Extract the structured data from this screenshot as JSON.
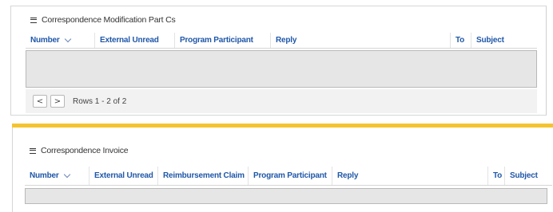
{
  "panel1": {
    "title": "Correspondence Modification Part Cs",
    "columns": [
      "Number",
      "External Unread",
      "Program Participant",
      "Reply",
      "To",
      "Subject"
    ],
    "pagination": {
      "prev_label": "<",
      "next_label": ">",
      "rows_text": "Rows 1 - 2 of 2"
    }
  },
  "panel2": {
    "title": "Correspondence Invoice",
    "columns": [
      "Number",
      "External Unread",
      "Reimbursement Claim",
      "Program Participant",
      "Reply",
      "To",
      "Subject"
    ]
  },
  "colors": {
    "header_text": "#1f57a8",
    "accent_bar": "#f4c430",
    "empty_body": "#e6e6e6",
    "footer_bg": "#f2f2f2"
  }
}
